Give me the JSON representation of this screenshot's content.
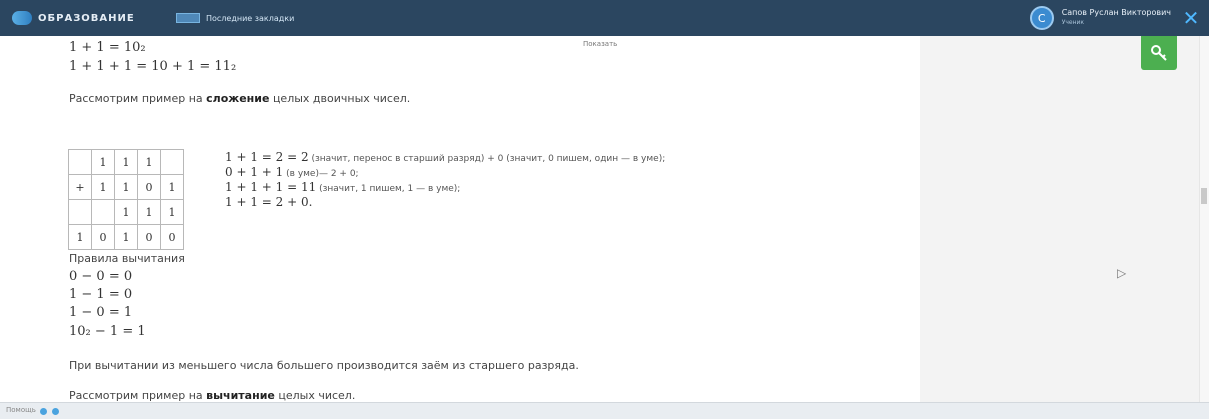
{
  "header": {
    "logo_text": "образование",
    "bookmark_label": "Последние закладки",
    "user_name": "Сапов Руслан Викторович",
    "user_role": "Ученик",
    "avatar_initial": "С",
    "close_symbol": "✕"
  },
  "content": {
    "show_link": "Показать",
    "eq1": "1 + 1 = 10₂",
    "eq2": "1 + 1 + 1 = 10 + 1 = 11₂",
    "add_intro_pre": "Рассмотрим пример на ",
    "add_intro_bold": "сложение",
    "add_intro_post": " целых двоичных чисел.",
    "table": {
      "rows": [
        [
          "",
          "1",
          "1",
          "1",
          ""
        ],
        [
          "+",
          "1",
          "1",
          "0",
          "1"
        ],
        [
          "",
          "",
          "1",
          "1",
          "1"
        ],
        [
          "1",
          "0",
          "1",
          "0",
          "0"
        ]
      ],
      "red_cells": [
        "0-1",
        "0-2",
        "0-3"
      ]
    },
    "explanations": [
      {
        "math": "1 + 1 = 2 = 2",
        "text": " (значит, перенос в старший разряд) + 0 (значит, 0 пишем, один — в уме);"
      },
      {
        "math": "0 + 1 + 1",
        "text": " (в уме)— 2 + 0;"
      },
      {
        "math": "1 + 1 + 1 = 11",
        "text": " (значит, 1 пишем, 1 — в уме);"
      },
      {
        "math": "1 + 1 = 2 + 0.",
        "text": ""
      }
    ],
    "sub_title": "Правила вычитания",
    "sub_rules": [
      "0 − 0 = 0",
      "1 − 1 = 0",
      "1 − 0 = 1",
      "10₂ − 1 = 1"
    ],
    "borrow_text": "При вычитании из меньшего числа большего производится заём из старшего разряда.",
    "sub_example_pre": "Рассмотрим пример на ",
    "sub_example_bold": "вычитание",
    "sub_example_post": " целых чисел."
  },
  "side": {
    "key_icon": "key-icon"
  },
  "status": {
    "text": "Помощь"
  },
  "colors": {
    "topbar": "#2b4660",
    "accent_green": "#4caf50",
    "red_digit": "#c62828"
  }
}
